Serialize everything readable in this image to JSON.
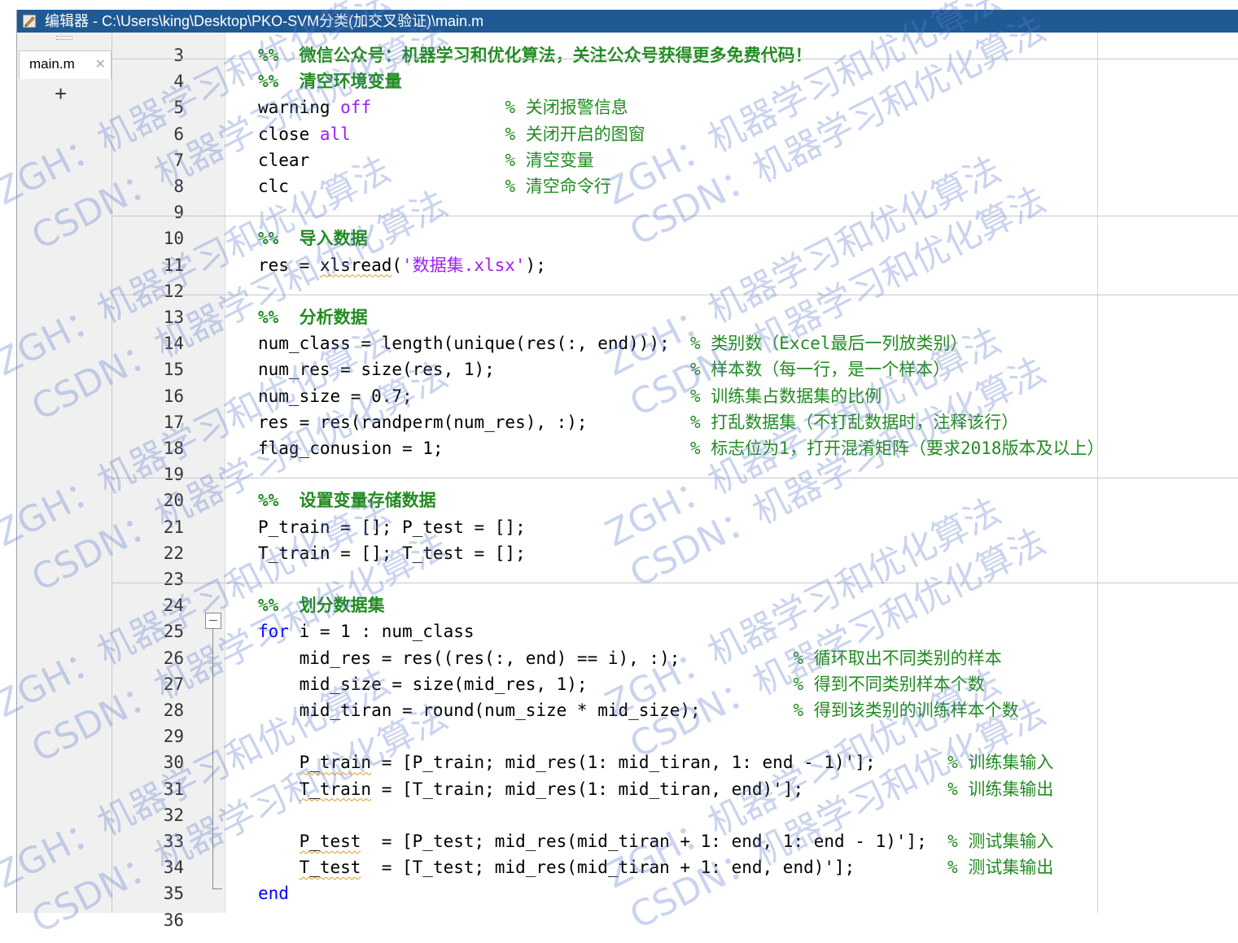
{
  "window": {
    "title": "编辑器 - C:\\Users\\king\\Desktop\\PKO-SVM分类(加交叉验证)\\main.m",
    "icon": "editor-icon"
  },
  "tabs": [
    {
      "label": "main.m",
      "close": "✕",
      "active": true
    }
  ],
  "add_tab": "+",
  "code": {
    "line_numbers": [
      "3",
      "4",
      "5",
      "6",
      "7",
      "8",
      "9",
      "10",
      "11",
      "12",
      "13",
      "14",
      "15",
      "16",
      "17",
      "18",
      "19",
      "20",
      "21",
      "22",
      "23",
      "24",
      "25",
      "26",
      "27",
      "28",
      "29",
      "30",
      "31",
      "32",
      "33",
      "34",
      "35",
      "36"
    ],
    "lines": [
      [
        {
          "t": "%%  微信公众号：机器学习和优化算法，关注公众号获得更多免费代码！",
          "c": "sec"
        }
      ],
      [
        {
          "t": "%%  清空环境变量",
          "c": "sec"
        }
      ],
      [
        {
          "t": "warning ",
          "c": ""
        },
        {
          "t": "off",
          "c": "str"
        },
        {
          "t": "             ",
          "c": ""
        },
        {
          "t": "% 关闭报警信息",
          "c": "cm"
        }
      ],
      [
        {
          "t": "close ",
          "c": ""
        },
        {
          "t": "all",
          "c": "str"
        },
        {
          "t": "               ",
          "c": ""
        },
        {
          "t": "% 关闭开启的图窗",
          "c": "cm"
        }
      ],
      [
        {
          "t": "clear                   ",
          "c": ""
        },
        {
          "t": "% 清空变量",
          "c": "cm"
        }
      ],
      [
        {
          "t": "clc                     ",
          "c": ""
        },
        {
          "t": "% 清空命令行",
          "c": "cm"
        }
      ],
      [],
      [
        {
          "t": "%%  导入数据",
          "c": "sec"
        }
      ],
      [
        {
          "t": "res = ",
          "c": ""
        },
        {
          "t": "xlsread",
          "c": "sq"
        },
        {
          "t": "(",
          "c": ""
        },
        {
          "t": "'数据集.xlsx'",
          "c": "str"
        },
        {
          "t": ");",
          "c": ""
        }
      ],
      [],
      [
        {
          "t": "%%  分析数据",
          "c": "sec"
        }
      ],
      [
        {
          "t": "num_class = length(unique(res(:, end)));  ",
          "c": ""
        },
        {
          "t": "% 类别数（Excel最后一列放类别）",
          "c": "cm"
        }
      ],
      [
        {
          "t": "num_res = size(res, 1);                   ",
          "c": ""
        },
        {
          "t": "% 样本数（每一行，是一个样本）",
          "c": "cm"
        }
      ],
      [
        {
          "t": "num_size = 0.7;                           ",
          "c": ""
        },
        {
          "t": "% 训练集占数据集的比例",
          "c": "cm"
        }
      ],
      [
        {
          "t": "res = res(randperm(num_res), :);          ",
          "c": ""
        },
        {
          "t": "% 打乱数据集（不打乱数据时，注释该行）",
          "c": "cm"
        }
      ],
      [
        {
          "t": "flag_conusion = 1;                        ",
          "c": ""
        },
        {
          "t": "% 标志位为1，打开混淆矩阵（要求2018版本及以上）",
          "c": "cm"
        }
      ],
      [],
      [
        {
          "t": "%%  设置变量存储数据",
          "c": "sec"
        }
      ],
      [
        {
          "t": "P_train = []; P_test = [];",
          "c": ""
        }
      ],
      [
        {
          "t": "T_train = []; T_test = [];",
          "c": ""
        }
      ],
      [],
      [
        {
          "t": "%%  划分数据集",
          "c": "sec"
        }
      ],
      [
        {
          "t": "for",
          "c": "kw"
        },
        {
          "t": " i = 1 : num_class",
          "c": ""
        }
      ],
      [
        {
          "t": "    mid_res = res((res(:, end) == i), :);           ",
          "c": ""
        },
        {
          "t": "% 循环取出不同类别的样本",
          "c": "cm"
        }
      ],
      [
        {
          "t": "    mid_size = size(mid_res, 1);                    ",
          "c": ""
        },
        {
          "t": "% 得到不同类别样本个数",
          "c": "cm"
        }
      ],
      [
        {
          "t": "    mid_tiran = round(num_size * mid_size);         ",
          "c": ""
        },
        {
          "t": "% 得到该类别的训练样本个数",
          "c": "cm"
        }
      ],
      [],
      [
        {
          "t": "    ",
          "c": ""
        },
        {
          "t": "P_train",
          "c": "sq"
        },
        {
          "t": " = [P_train; mid_res(1: mid_tiran, 1: end - 1)'];       ",
          "c": ""
        },
        {
          "t": "% 训练集输入",
          "c": "cm"
        }
      ],
      [
        {
          "t": "    ",
          "c": ""
        },
        {
          "t": "T_train",
          "c": "sq"
        },
        {
          "t": " = [T_train; mid_res(1: mid_tiran, end)'];              ",
          "c": ""
        },
        {
          "t": "% 训练集输出",
          "c": "cm"
        }
      ],
      [],
      [
        {
          "t": "    ",
          "c": ""
        },
        {
          "t": "P_test",
          "c": "sq"
        },
        {
          "t": "  = [P_test; mid_res(mid_tiran + 1: end, 1: end - 1)'];  ",
          "c": ""
        },
        {
          "t": "% 测试集输入",
          "c": "cm"
        }
      ],
      [
        {
          "t": "    ",
          "c": ""
        },
        {
          "t": "T_test",
          "c": "sq"
        },
        {
          "t": "  = [T_test; mid_res(mid_tiran + 1: end, end)'];         ",
          "c": ""
        },
        {
          "t": "% 测试集输出",
          "c": "cm"
        }
      ],
      [
        {
          "t": "end",
          "c": "kw"
        }
      ],
      []
    ]
  },
  "watermark": {
    "zgh": "ZGH：机器学习和优化算法",
    "csdn": "CSDN：机器学习和优化算法"
  },
  "colors": {
    "titlebar": "#1f5a94",
    "keyword": "#0000ff",
    "string": "#a020f0",
    "comment": "#228b22",
    "watermark": "#5f7dcd"
  }
}
